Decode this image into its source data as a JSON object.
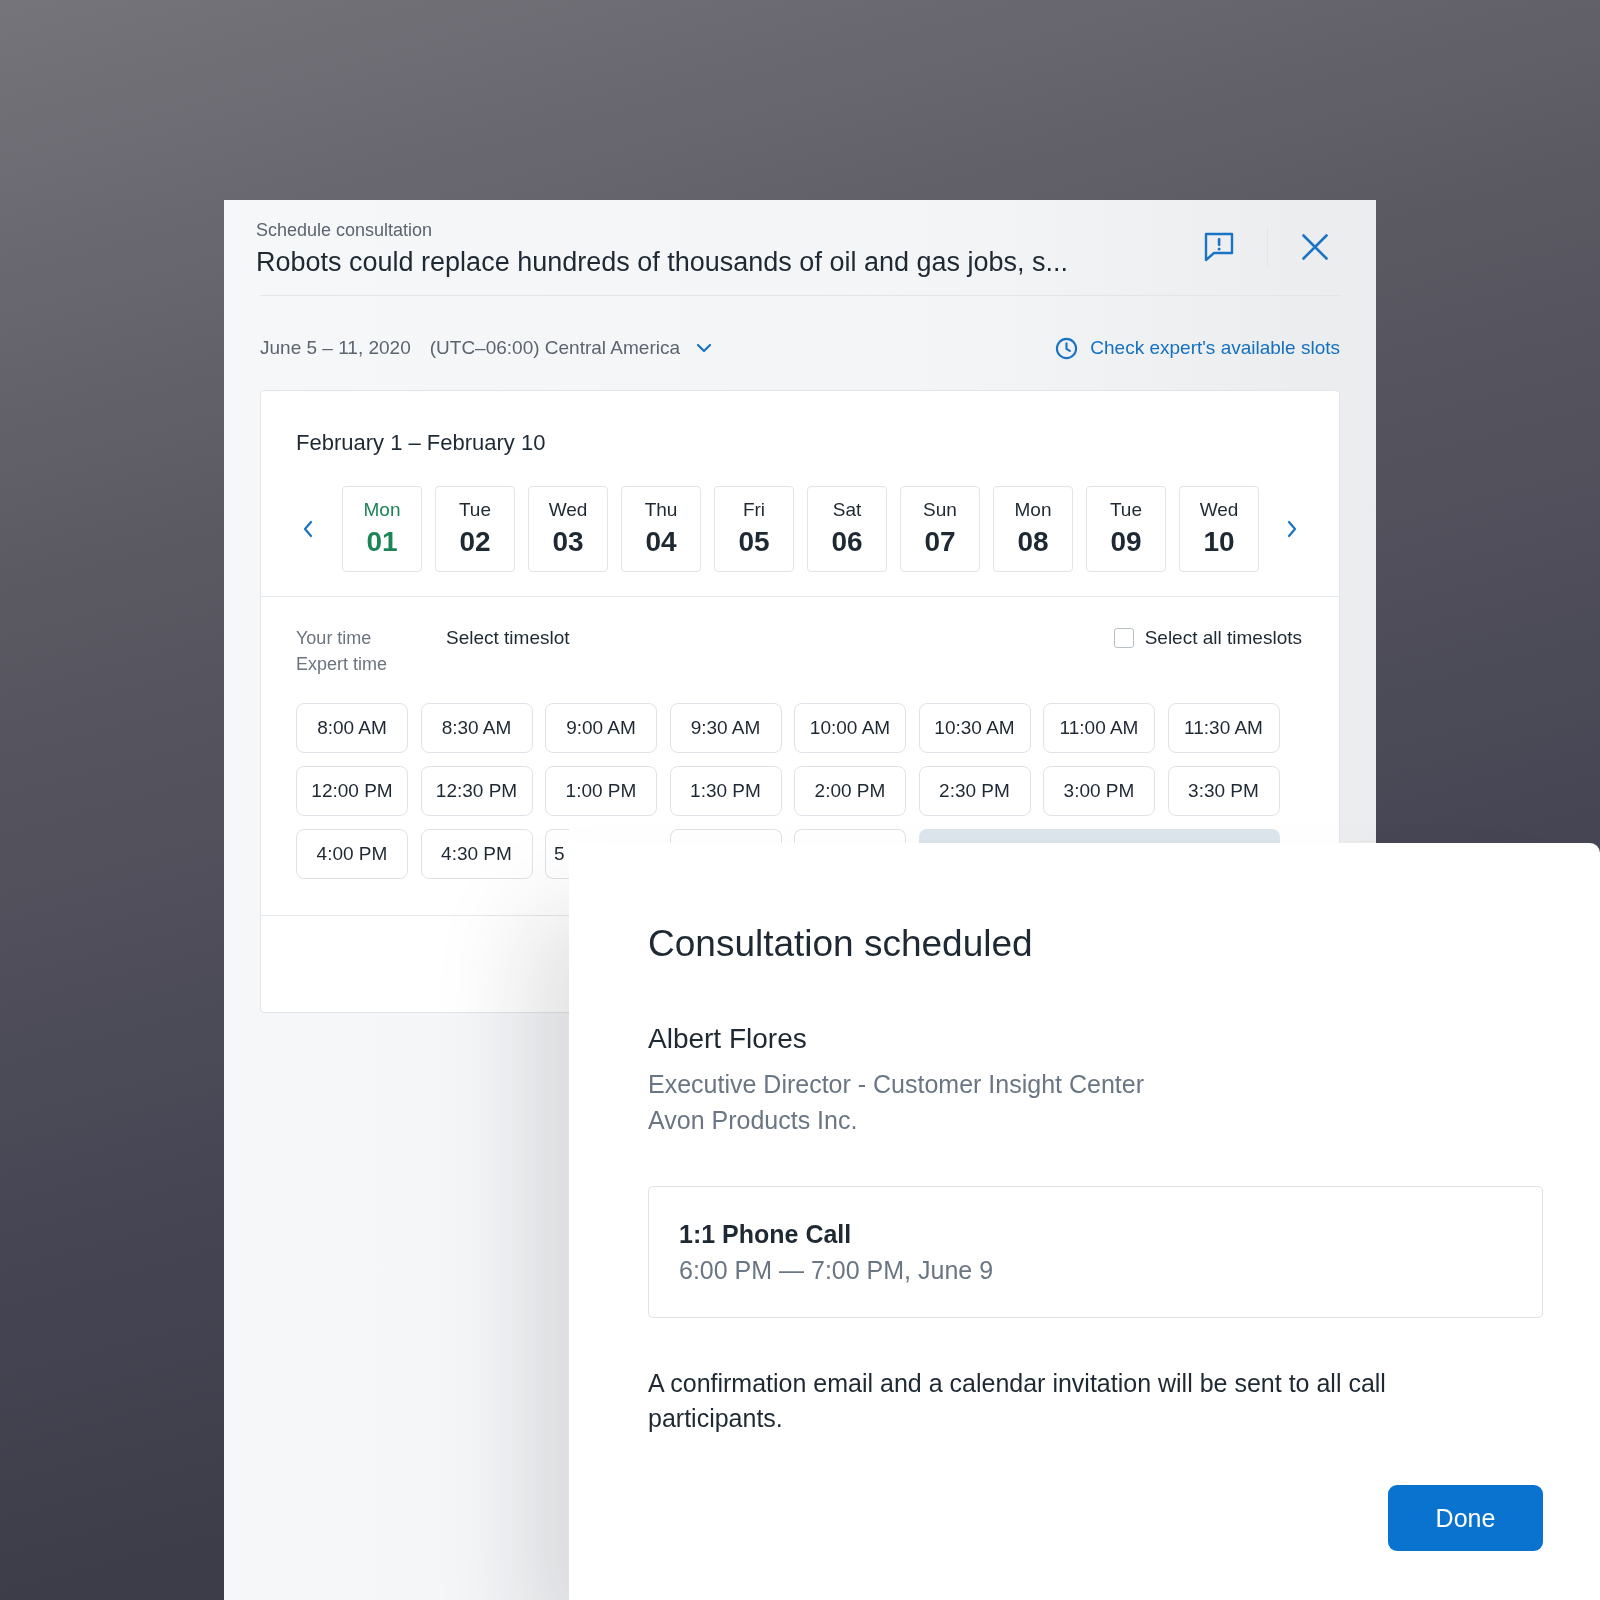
{
  "header": {
    "subtitle": "Schedule consultation",
    "title": "Robots could replace hundreds of thousands of oil and gas jobs, s..."
  },
  "filters": {
    "date_range": "June 5 – 11, 2020",
    "timezone": "(UTC–06:00) Central America",
    "slots_link": "Check expert's available slots"
  },
  "calendar": {
    "range_title": "February 1 – February 10",
    "days": [
      {
        "weekday": "Mon",
        "date": "01",
        "selected": true
      },
      {
        "weekday": "Tue",
        "date": "02",
        "selected": false
      },
      {
        "weekday": "Wed",
        "date": "03",
        "selected": false
      },
      {
        "weekday": "Thu",
        "date": "04",
        "selected": false
      },
      {
        "weekday": "Fri",
        "date": "05",
        "selected": false
      },
      {
        "weekday": "Sat",
        "date": "06",
        "selected": false
      },
      {
        "weekday": "Sun",
        "date": "07",
        "selected": false
      },
      {
        "weekday": "Mon",
        "date": "08",
        "selected": false
      },
      {
        "weekday": "Tue",
        "date": "09",
        "selected": false
      },
      {
        "weekday": "Wed",
        "date": "10",
        "selected": false
      }
    ]
  },
  "timeslots": {
    "time_labels": [
      "Your time",
      "Expert time"
    ],
    "heading": "Select timeslot",
    "select_all": {
      "label": "Select all timeslots",
      "checked": false
    },
    "slots": [
      {
        "kind": "slot",
        "label": "8:00 AM"
      },
      {
        "kind": "slot",
        "label": "8:30 AM"
      },
      {
        "kind": "slot",
        "label": "9:00 AM"
      },
      {
        "kind": "slot",
        "label": "9:30 AM"
      },
      {
        "kind": "slot",
        "label": "10:00 AM"
      },
      {
        "kind": "slot",
        "label": "10:30 AM"
      },
      {
        "kind": "slot",
        "label": "11:00 AM"
      },
      {
        "kind": "slot",
        "label": "11:30 AM"
      },
      {
        "kind": "slot",
        "label": "12:00 PM"
      },
      {
        "kind": "slot",
        "label": "12:30 PM"
      },
      {
        "kind": "slot",
        "label": "1:00 PM"
      },
      {
        "kind": "slot",
        "label": "1:30 PM"
      },
      {
        "kind": "slot",
        "label": "2:00 PM"
      },
      {
        "kind": "slot",
        "label": "2:30 PM"
      },
      {
        "kind": "slot",
        "label": "3:00 PM"
      },
      {
        "kind": "slot",
        "label": "3:30 PM"
      },
      {
        "kind": "slot",
        "label": "4:00 PM"
      },
      {
        "kind": "slot",
        "label": "4:30 PM"
      },
      {
        "kind": "partial",
        "label": "5"
      },
      {
        "kind": "stub"
      },
      {
        "kind": "stub"
      },
      {
        "kind": "band"
      }
    ]
  },
  "confirmation": {
    "title": "Consultation scheduled",
    "expert": {
      "name": "Albert Flores",
      "role": "Executive Director - Customer Insight Center",
      "company": "Avon Products Inc."
    },
    "call": {
      "type": "1:1 Phone Call",
      "time": "6:00 PM — 7:00 PM, June 9"
    },
    "message": "A confirmation email and a calendar invitation will be sent to all call participants.",
    "done_button": "Done"
  }
}
